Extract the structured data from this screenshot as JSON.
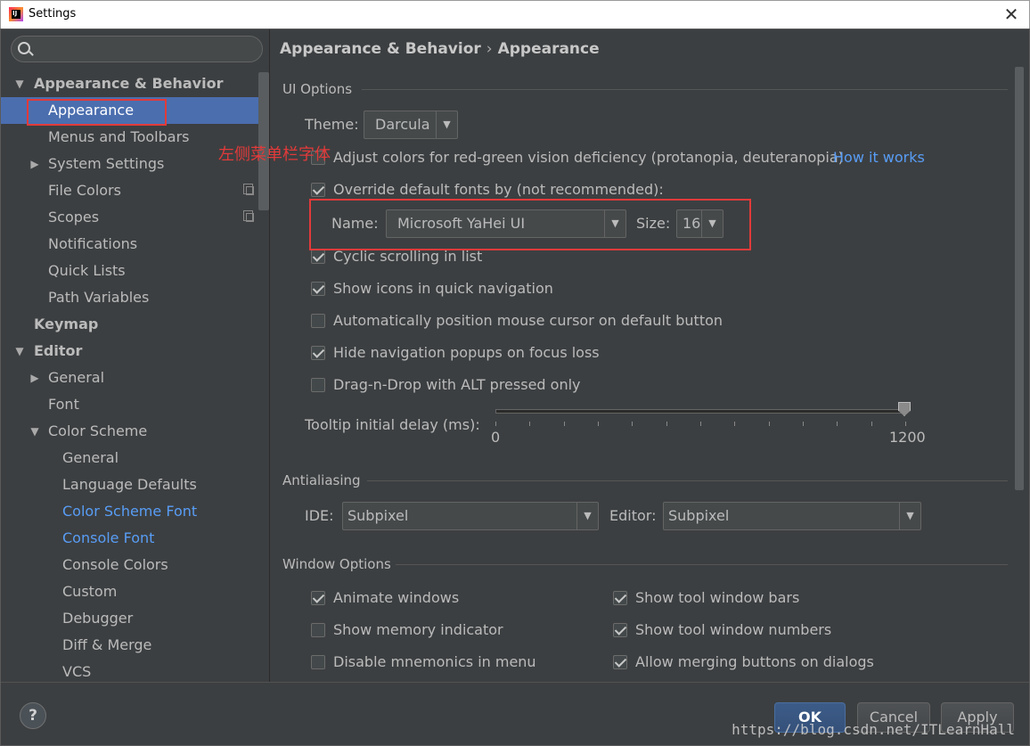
{
  "window": {
    "title": "Settings"
  },
  "search": {
    "placeholder": ""
  },
  "sidebar": {
    "items": [
      {
        "label": "Appearance & Behavior",
        "arrow": "▼"
      },
      {
        "label": "Appearance"
      },
      {
        "label": "Menus and Toolbars"
      },
      {
        "label": "System Settings",
        "arrow": "▶"
      },
      {
        "label": "File Colors"
      },
      {
        "label": "Scopes"
      },
      {
        "label": "Notifications"
      },
      {
        "label": "Quick Lists"
      },
      {
        "label": "Path Variables"
      },
      {
        "label": "Keymap"
      },
      {
        "label": "Editor",
        "arrow": "▼"
      },
      {
        "label": "General",
        "arrow": "▶"
      },
      {
        "label": "Font"
      },
      {
        "label": "Color Scheme",
        "arrow": "▼"
      },
      {
        "label": "General"
      },
      {
        "label": "Language Defaults"
      },
      {
        "label": "Color Scheme Font"
      },
      {
        "label": "Console Font"
      },
      {
        "label": "Console Colors"
      },
      {
        "label": "Custom"
      },
      {
        "label": "Debugger"
      },
      {
        "label": "Diff & Merge"
      },
      {
        "label": "VCS"
      }
    ]
  },
  "annotation": {
    "note": "左侧菜单栏字体"
  },
  "breadcrumb": {
    "parent": "Appearance & Behavior",
    "separator": "›",
    "current": "Appearance"
  },
  "ui_options": {
    "section_title": "UI Options",
    "theme_label": "Theme:",
    "theme_value": "Darcula",
    "color_deficiency_label": "Adjust colors for red-green vision deficiency (protanopia, deuteranopia)",
    "color_deficiency_checked": false,
    "how_it_works": "How it works",
    "override_fonts_label": "Override default fonts by (not recommended):",
    "override_fonts_checked": true,
    "name_label": "Name:",
    "name_value": "Microsoft YaHei UI",
    "size_label": "Size:",
    "size_value": "16",
    "cyclic_scrolling_label": "Cyclic scrolling in list",
    "cyclic_scrolling_checked": true,
    "show_icons_label": "Show icons in quick navigation",
    "show_icons_checked": true,
    "auto_position_label": "Automatically position mouse cursor on default button",
    "auto_position_checked": false,
    "hide_popups_label": "Hide navigation popups on focus loss",
    "hide_popups_checked": true,
    "drag_drop_label": "Drag-n-Drop with ALT pressed only",
    "drag_drop_checked": false,
    "tooltip_label": "Tooltip initial delay (ms):",
    "tooltip_min": "0",
    "tooltip_max": "1200",
    "tooltip_value": 1200
  },
  "antialiasing": {
    "section_title": "Antialiasing",
    "ide_label": "IDE:",
    "ide_value": "Subpixel",
    "editor_label": "Editor:",
    "editor_value": "Subpixel"
  },
  "window_options": {
    "section_title": "Window Options",
    "animate_windows": {
      "label": "Animate windows",
      "checked": true
    },
    "show_tool_window_bars": {
      "label": "Show tool window bars",
      "checked": true
    },
    "show_memory_indicator": {
      "label": "Show memory indicator",
      "checked": false
    },
    "show_tool_window_numbers": {
      "label": "Show tool window numbers",
      "checked": true
    },
    "disable_mnemonics": {
      "label": "Disable mnemonics in menu",
      "checked": false
    },
    "allow_merging_buttons": {
      "label": "Allow merging buttons on dialogs",
      "checked": true
    }
  },
  "footer": {
    "help_label": "?",
    "ok_label": "OK",
    "cancel_label": "Cancel",
    "apply_label": "Apply",
    "watermark": "https://blog.csdn.net/ITLearnHall"
  },
  "colors": {
    "background": "#3c3f41",
    "selection": "#4b6eaf",
    "link": "#589df6",
    "text": "#bbbbbb",
    "annotation": "#e23a3a"
  }
}
